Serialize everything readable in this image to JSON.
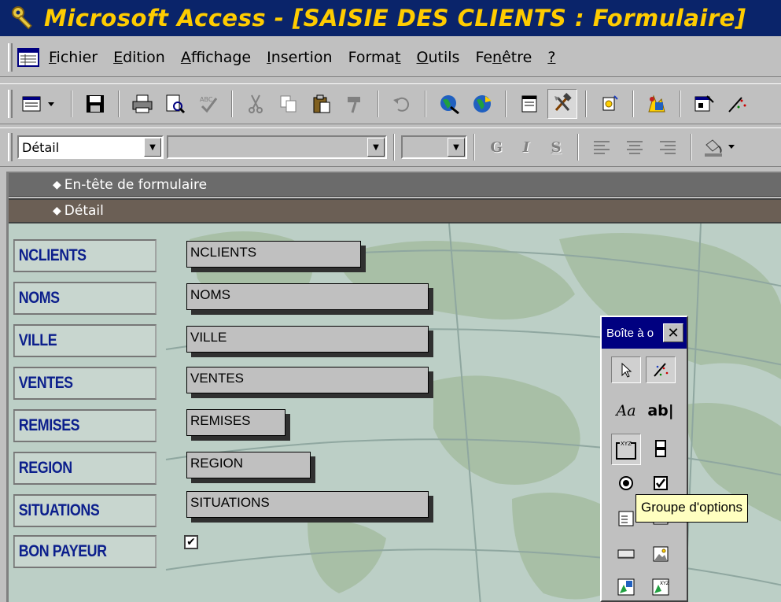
{
  "window": {
    "title": "Microsoft Access - [SAISIE DES CLIENTS : Formulaire]",
    "title_color": "#ffcc00",
    "titlebar_color": "#0a246a"
  },
  "menu": {
    "items": [
      {
        "label": "Fichier"
      },
      {
        "label": "Edition"
      },
      {
        "label": "Affichage"
      },
      {
        "label": "Insertion"
      },
      {
        "label": "Format"
      },
      {
        "label": "Outils"
      },
      {
        "label": "Fenêtre"
      },
      {
        "label": "?"
      }
    ]
  },
  "format_toolbar": {
    "object_selector": "Détail",
    "font_selector": "",
    "size_selector": "",
    "bold": "G",
    "italic": "I",
    "underline": "S"
  },
  "sections": {
    "header": "En-tête de formulaire",
    "detail": "Détail"
  },
  "form": {
    "label_color": "#0c1f8c",
    "rows": [
      {
        "label": "NCLIENTS",
        "field": "NCLIENTS"
      },
      {
        "label": "NOMS",
        "field": "NOMS"
      },
      {
        "label": "VILLE",
        "field": "VILLE"
      },
      {
        "label": "VENTES",
        "field": "VENTES"
      },
      {
        "label": "REMISES",
        "field": "REMISES"
      },
      {
        "label": "REGION",
        "field": "REGION"
      },
      {
        "label": "SITUATIONS",
        "field": "SITUATIONS"
      },
      {
        "label": "BON PAYEUR",
        "field": ""
      }
    ],
    "bon_payeur_checked": "✔"
  },
  "toolbox": {
    "title": "Boîte à o",
    "close": "✕",
    "label_tool": "Aa",
    "textbox_tool": "ab|",
    "tooltip": "Groupe d'options"
  }
}
